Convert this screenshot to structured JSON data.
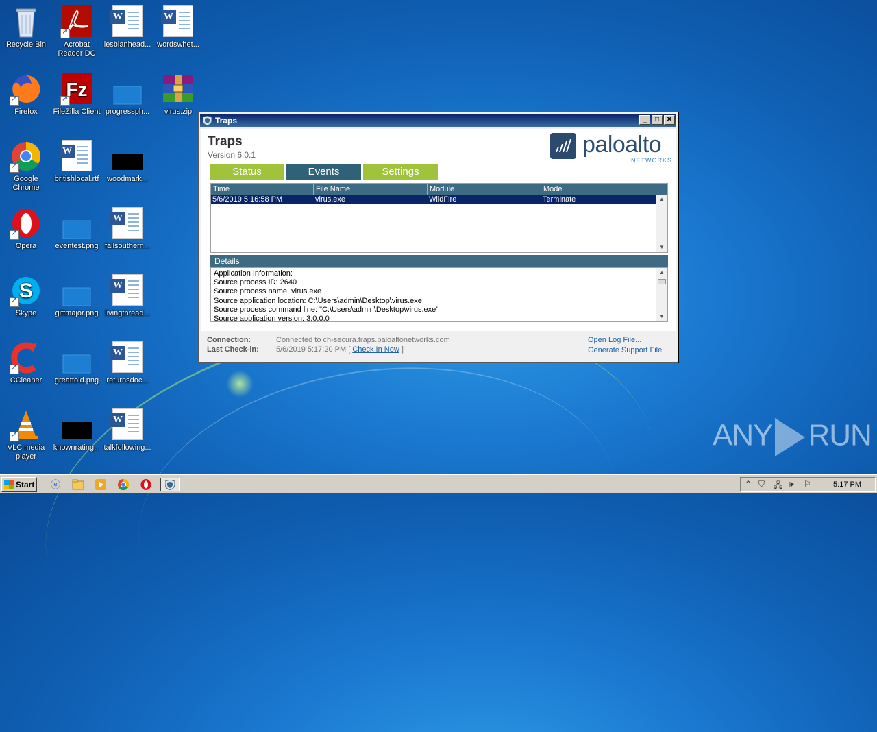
{
  "desktop": {
    "icons": [
      {
        "label": "Recycle Bin"
      },
      {
        "label": "Acrobat Reader DC"
      },
      {
        "label": "lesbianhead..."
      },
      {
        "label": "wordswhet..."
      },
      {
        "label": "Firefox"
      },
      {
        "label": "FileZilla Client"
      },
      {
        "label": "progressph..."
      },
      {
        "label": "virus.zip"
      },
      {
        "label": "Google Chrome"
      },
      {
        "label": "britishlocal.rtf"
      },
      {
        "label": "woodmark..."
      },
      {
        "label": "Opera"
      },
      {
        "label": "eventest.png"
      },
      {
        "label": "fallsouthern..."
      },
      {
        "label": "Skype"
      },
      {
        "label": "giftmajor.png"
      },
      {
        "label": "livingthread..."
      },
      {
        "label": "CCleaner"
      },
      {
        "label": "greattold.png"
      },
      {
        "label": "returnsdoc..."
      },
      {
        "label": "VLC media player"
      },
      {
        "label": "knownrating..."
      },
      {
        "label": "talkfollowing..."
      }
    ]
  },
  "window": {
    "title": "Traps",
    "app_name": "Traps",
    "version": "Version 6.0.1",
    "logo": {
      "palo": "palo",
      "alto": "alto",
      "sub": "NETWORKS"
    },
    "tabs": [
      {
        "label": "Status"
      },
      {
        "label": "Events"
      },
      {
        "label": "Settings"
      }
    ],
    "active_tab": "Events",
    "events_table": {
      "columns": [
        "Time",
        "File Name",
        "Module",
        "Mode"
      ],
      "rows": [
        {
          "time": "5/6/2019 5:16:58 PM",
          "file": "virus.exe",
          "module": "WildFire",
          "mode": "Terminate"
        }
      ]
    },
    "details": {
      "header": "Details",
      "text": "Application Information:\nSource process ID: 2640\nSource process name: virus.exe\nSource application location: C:\\Users\\admin\\Desktop\\virus.exe\nSource process command line: \"C:\\Users\\admin\\Desktop\\virus.exe\"\nSource application version: 3.0.0.0"
    },
    "status": {
      "connection_label": "Connection:",
      "connection_value": "Connected to ch-secura.traps.paloaltonetworks.com",
      "checkin_label": "Last Check-in:",
      "checkin_value": "5/6/2019 5:17:20 PM [",
      "checkin_link": "Check In Now",
      "checkin_close": "]",
      "open_log": "Open Log File...",
      "support_file": "Generate Support File"
    },
    "colors": {
      "tab_green": "#9fc33b",
      "tab_blue": "#2f6279",
      "header_blue": "#3c6b83",
      "selection": "#0a246a"
    }
  },
  "taskbar": {
    "start_label": "Start",
    "clock": "5:17 PM"
  },
  "watermark": {
    "left": "ANY",
    "right": "RUN"
  }
}
